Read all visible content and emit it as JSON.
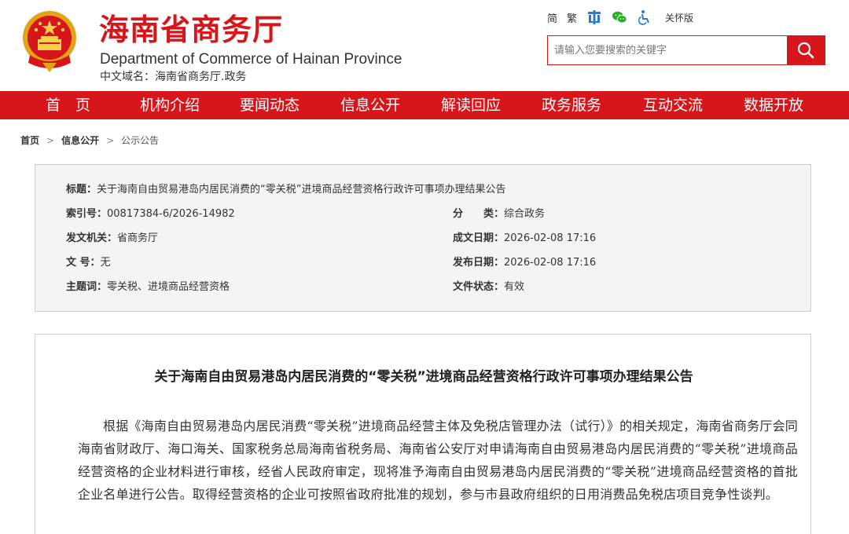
{
  "header": {
    "title": "海南省商务厅",
    "subtitle": "Department of Commerce of Hainan Province",
    "domain": "中文域名：海南省商务厅.政务"
  },
  "topbar": {
    "simplified": "简",
    "traditional": "繁",
    "care_mode": "关怀版"
  },
  "search": {
    "placeholder": "请输入您要搜索的关键字"
  },
  "nav": {
    "items": [
      "首　页",
      "机构介绍",
      "要闻动态",
      "信息公开",
      "解读回应",
      "政务服务",
      "互动交流",
      "数据开放"
    ]
  },
  "breadcrumb": {
    "items": [
      "首页",
      "信息公开",
      "公示公告"
    ],
    "separator": ">"
  },
  "meta": {
    "title_label": "标题：",
    "title_value": "关于海南自由贸易港岛内居民消费的“零关税”进境商品经营资格行政许可事项办理结果公告",
    "index_label": "索引号：",
    "index_value": "00817384-6/2026-14982",
    "category_label": "分　　类：",
    "category_value": "综合政务",
    "issuer_label": "发文机关：",
    "issuer_value": "省商务厅",
    "created_label": "成文日期：",
    "created_value": "2026-02-08 17:16",
    "docno_label": "文 号：",
    "docno_value": "无",
    "published_label": "发布日期：",
    "published_value": "2026-02-08 17:16",
    "keywords_label": "主题词：",
    "keywords_value": "零关税、进境商品经营资格",
    "status_label": "文件状态：",
    "status_value": "有效"
  },
  "article": {
    "title": "关于海南自由贸易港岛内居民消费的“零关税”进境商品经营资格行政许可事项办理结果公告",
    "body": "根据《海南自由贸易港岛内居民消费“零关税”进境商品经营主体及免税店管理办法（试行）》的相关规定，海南省商务厅会同海南省财政厅、海口海关、国家税务总局海南省税务局、海南省公安厅对申请海南自由贸易港岛内居民消费的“零关税”进境商品经营资格的企业材料进行审核，经省人民政府审定，现将准予海南自由贸易港岛内居民消费的“零关税”进境商品经营资格的首批企业名单进行公告。取得经营资格的企业可按照省政府批准的规划，参与市县政府组织的日用消费品免税店项目竞争性谈判。"
  },
  "colors": {
    "brand_red": "#d7161c",
    "wechat_green": "#2aae2a",
    "accessibility_blue": "#2b7bd6"
  },
  "icons": [
    "national-emblem",
    "tree-icon",
    "wechat-icon",
    "accessibility-icon",
    "search-icon"
  ]
}
